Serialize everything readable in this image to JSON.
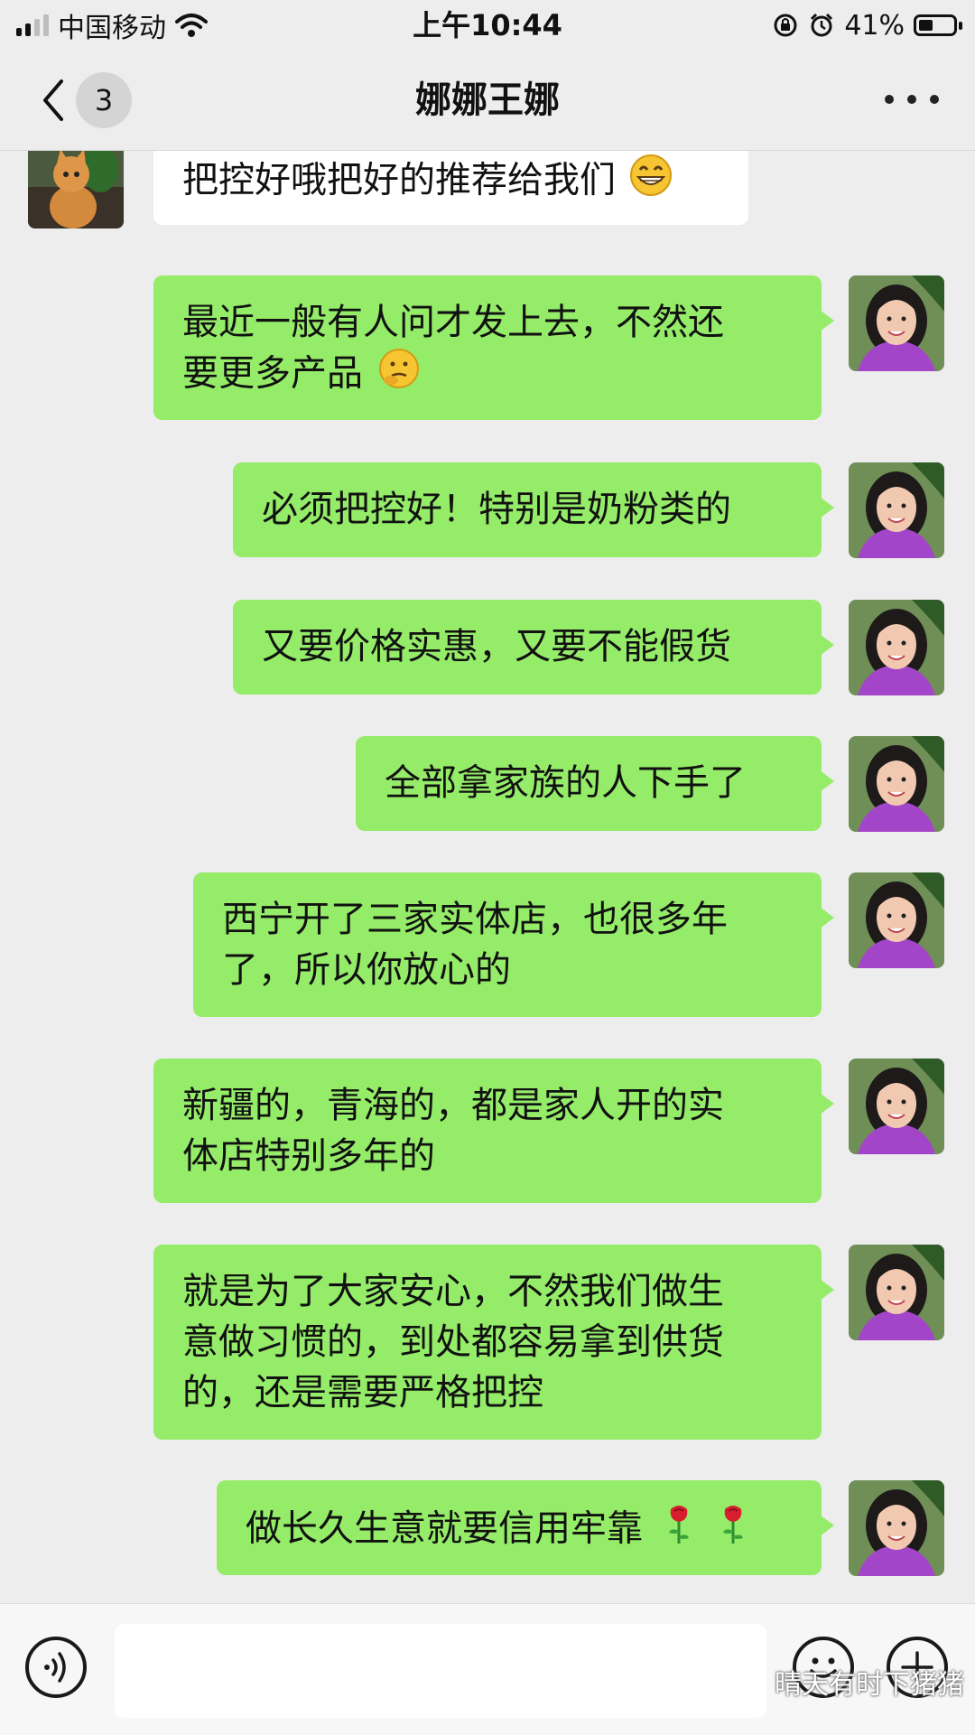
{
  "status_bar": {
    "carrier": "中国移动",
    "time": "上午10:44",
    "battery_percent_text": "41%",
    "battery_level": 0.41
  },
  "nav": {
    "unread_count": "3",
    "title": "娜娜王娜"
  },
  "messages": [
    {
      "direction": "incoming",
      "lines": [
        "把控好哦把好的推荐给我们"
      ],
      "emoji": "grinning-face"
    },
    {
      "direction": "outgoing",
      "lines": [
        "最近一般有人问才发上去，不然还",
        "要更多产品"
      ],
      "emoji": "thinking-face"
    },
    {
      "direction": "outgoing",
      "lines": [
        "必须把控好！特别是奶粉类的"
      ]
    },
    {
      "direction": "outgoing",
      "lines": [
        "又要价格实惠，又要不能假货"
      ]
    },
    {
      "direction": "outgoing",
      "lines": [
        "全部拿家族的人下手了"
      ]
    },
    {
      "direction": "outgoing",
      "lines": [
        "西宁开了三家实体店，也很多年",
        "了，所以你放心的"
      ]
    },
    {
      "direction": "outgoing",
      "lines": [
        "新疆的，青海的，都是家人开的实",
        "体店特别多年的"
      ]
    },
    {
      "direction": "outgoing",
      "lines": [
        "就是为了大家安心，不然我们做生",
        "意做习惯的，到处都容易拿到供货",
        "的，还是需要严格把控"
      ]
    },
    {
      "direction": "outgoing",
      "lines": [
        "做长久生意就要信用牢靠"
      ],
      "emoji": "rose-rose"
    }
  ],
  "input_bar": {
    "text_value": "",
    "watermark": "晴天有时下猪猪"
  },
  "colors": {
    "background": "#ededed",
    "outgoing_bubble": "#95ec69",
    "incoming_bubble": "#ffffff"
  }
}
